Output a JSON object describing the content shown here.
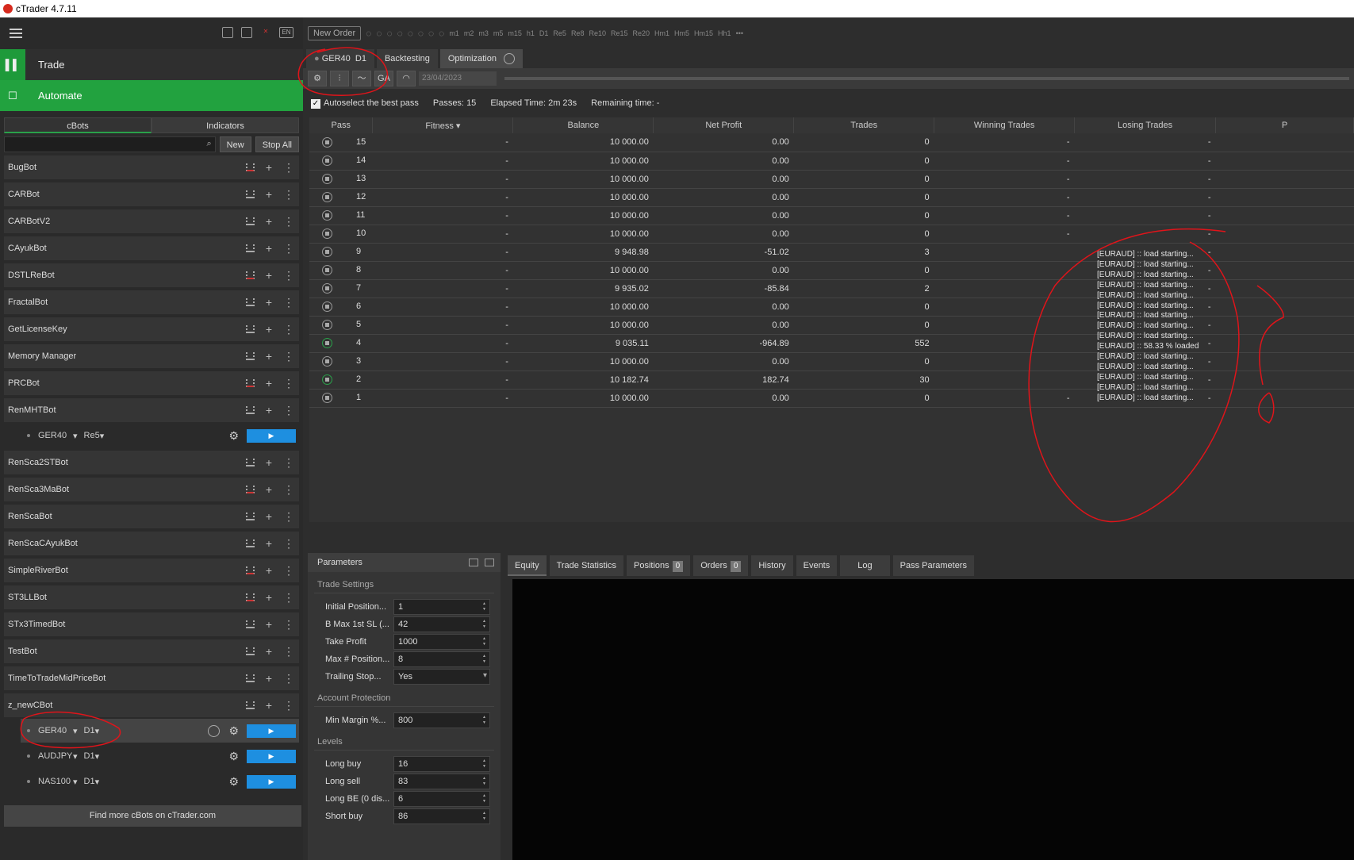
{
  "app_title": "cTrader 4.7.11",
  "nav": {
    "trade": "Trade",
    "automate": "Automate"
  },
  "top_icons": {
    "lang": "EN"
  },
  "left_tabs": [
    "cBots",
    "Indicators"
  ],
  "left_buttons": {
    "new": "New",
    "stop_all": "Stop All"
  },
  "bots": [
    "BugBot",
    "CARBot",
    "CARBotV2",
    "CAyukBot",
    "DSTLReBot",
    "FractalBot",
    "GetLicenseKey",
    "Memory Manager",
    "PRCBot",
    "RenMHTBot",
    "RenSca2STBot",
    "RenSca3MaBot",
    "RenScaBot",
    "RenScaCAyukBot",
    "SimpleRiverBot",
    "ST3LLBot",
    "STx3TimedBot",
    "TestBot",
    "TimeToTradeMidPriceBot",
    "z_newCBot"
  ],
  "renmht_instance": {
    "symbol": "GER40",
    "tf": "Re5"
  },
  "znew_instances": [
    {
      "symbol": "GER40",
      "tf": "D1"
    },
    {
      "symbol": "AUDJPY",
      "tf": "D1"
    },
    {
      "symbol": "NAS100",
      "tf": "D1"
    }
  ],
  "find_more": "Find more cBots on cTrader.com",
  "toolbar": {
    "new_order": "New Order",
    "timeframes": [
      "m1",
      "m2",
      "m3",
      "m5",
      "m15",
      "h1",
      "D1",
      "Re5",
      "Re8",
      "Re10",
      "Re15",
      "Re20",
      "Hm1",
      "Hm5",
      "Hm15",
      "Hh1"
    ]
  },
  "tabs": {
    "symbol": "GER40",
    "tf": "D1",
    "backtesting": "Backtesting",
    "optimization": "Optimization"
  },
  "ctrl": {
    "ga": "GA",
    "date": "23/04/2023"
  },
  "stats": {
    "autoselect": "Autoselect the best pass",
    "passes_label": "Passes:",
    "passes": "15",
    "elapsed_label": "Elapsed Time:",
    "elapsed": "2m 23s",
    "remaining_label": "Remaining time:",
    "remaining": "-"
  },
  "columns": [
    "Pass",
    "Fitness ▾",
    "Balance",
    "Net Profit",
    "Trades",
    "Winning Trades",
    "Losing Trades",
    "P"
  ],
  "rows": [
    {
      "pass": "15",
      "fit": "-",
      "bal": "10 000.00",
      "np": "0.00",
      "tr": "0",
      "win": "-",
      "lose": "-"
    },
    {
      "pass": "14",
      "fit": "-",
      "bal": "10 000.00",
      "np": "0.00",
      "tr": "0",
      "win": "-",
      "lose": "-"
    },
    {
      "pass": "13",
      "fit": "-",
      "bal": "10 000.00",
      "np": "0.00",
      "tr": "0",
      "win": "-",
      "lose": "-"
    },
    {
      "pass": "12",
      "fit": "-",
      "bal": "10 000.00",
      "np": "0.00",
      "tr": "0",
      "win": "-",
      "lose": "-"
    },
    {
      "pass": "11",
      "fit": "-",
      "bal": "10 000.00",
      "np": "0.00",
      "tr": "0",
      "win": "-",
      "lose": "-"
    },
    {
      "pass": "10",
      "fit": "-",
      "bal": "10 000.00",
      "np": "0.00",
      "tr": "0",
      "win": "-",
      "lose": "-"
    },
    {
      "pass": "9",
      "fit": "-",
      "bal": "9 948.98",
      "np": "-51.02",
      "tr": "3",
      "win": "",
      "lose": "-"
    },
    {
      "pass": "8",
      "fit": "-",
      "bal": "10 000.00",
      "np": "0.00",
      "tr": "0",
      "win": "",
      "lose": "-"
    },
    {
      "pass": "7",
      "fit": "-",
      "bal": "9 935.02",
      "np": "-85.84",
      "tr": "2",
      "win": "",
      "lose": "-"
    },
    {
      "pass": "6",
      "fit": "-",
      "bal": "10 000.00",
      "np": "0.00",
      "tr": "0",
      "win": "",
      "lose": "-"
    },
    {
      "pass": "5",
      "fit": "-",
      "bal": "10 000.00",
      "np": "0.00",
      "tr": "0",
      "win": "",
      "lose": "-"
    },
    {
      "pass": "4",
      "fit": "-",
      "bal": "9 035.11",
      "np": "-964.89",
      "tr": "552",
      "win": "",
      "lose": "-"
    },
    {
      "pass": "3",
      "fit": "-",
      "bal": "10 000.00",
      "np": "0.00",
      "tr": "0",
      "win": "",
      "lose": "-"
    },
    {
      "pass": "2",
      "fit": "-",
      "bal": "10 182.74",
      "np": "182.74",
      "tr": "30",
      "win": "",
      "lose": "-"
    },
    {
      "pass": "1",
      "fit": "-",
      "bal": "10 000.00",
      "np": "0.00",
      "tr": "0",
      "win": "-",
      "lose": "-"
    }
  ],
  "log_lines": [
    "[EURAUD] :: load starting...",
    "[EURAUD] :: load starting...",
    "[EURAUD] :: load starting...",
    "[EURAUD] :: load starting...",
    "[EURAUD] :: load starting...",
    "[EURAUD] :: load starting...",
    "[EURAUD] :: load starting...",
    "[EURAUD] :: load starting...",
    "[EURAUD] :: load starting...",
    "[EURAUD] :: 58.33 % loaded",
    "[EURAUD] :: load starting...",
    "[EURAUD] :: load starting...",
    "[EURAUD] :: load starting...",
    "[EURAUD] :: load starting...",
    "[EURAUD] :: load starting..."
  ],
  "params": {
    "title": "Parameters",
    "sec1": "Trade Settings",
    "p1": [
      "Initial Position...",
      "1"
    ],
    "p2": [
      "B Max 1st SL (...",
      "42"
    ],
    "p3": [
      "Take Profit",
      "1000"
    ],
    "p4": [
      "Max # Position...",
      "8"
    ],
    "p5": [
      "Trailing Stop...",
      "Yes"
    ],
    "sec2": "Account Protection",
    "p6": [
      "Min Margin %...",
      "800"
    ],
    "sec3": "Levels",
    "p7": [
      "Long buy",
      "16"
    ],
    "p8": [
      "Long sell",
      "83"
    ],
    "p9": [
      "Long BE (0 dis...",
      "6"
    ],
    "p10": [
      "Short buy",
      "86"
    ]
  },
  "bottom_tabs": {
    "equity": "Equity",
    "trade_stats": "Trade Statistics",
    "positions": "Positions",
    "positions_count": "0",
    "orders": "Orders",
    "orders_count": "0",
    "history": "History",
    "events": "Events",
    "log": "Log",
    "pass_params": "Pass Parameters"
  },
  "colors": {
    "accent_green": "#22a23f",
    "play_blue": "#1e8fe0",
    "annotation_red": "#e0141a"
  }
}
